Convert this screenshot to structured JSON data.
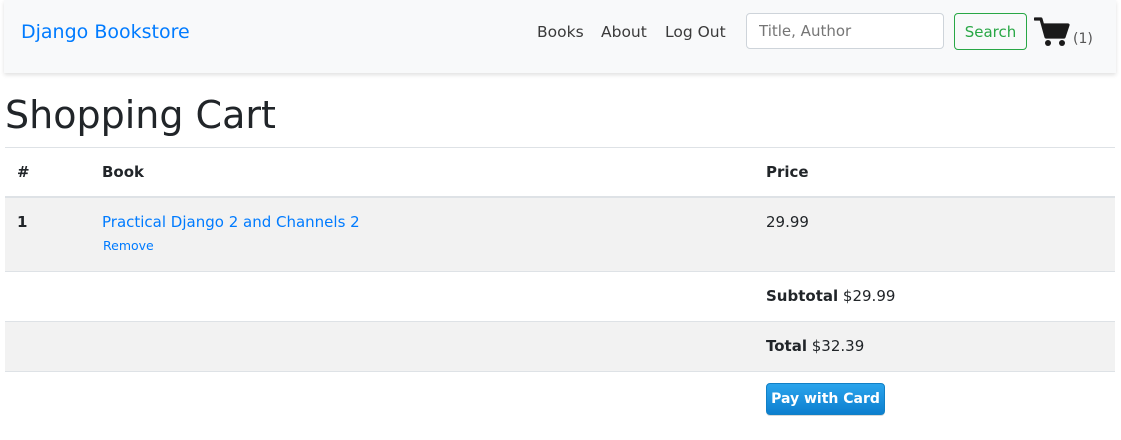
{
  "navbar": {
    "brand": "Django Bookstore",
    "links": [
      "Books",
      "About",
      "Log Out"
    ],
    "search_placeholder": "Title, Author",
    "search_button": "Search",
    "cart_icon": "shopping-cart-icon",
    "cart_count": "(1)"
  },
  "page": {
    "title": "Shopping Cart"
  },
  "table": {
    "headers": [
      "#",
      "Book",
      "Price"
    ],
    "items": [
      {
        "number": "1",
        "book": "Practical Django 2 and Channels 2",
        "remove_label": "Remove",
        "price": "29.99"
      }
    ],
    "subtotal_label": "Subtotal",
    "subtotal_value": "$29.99",
    "total_label": "Total",
    "total_value": "$32.39",
    "pay_button": "Pay with Card"
  },
  "colors": {
    "link": "#007bff",
    "search_button": "#28a745",
    "pay_button": "#1a8fdc",
    "navbar_bg": "#f8f9fa"
  }
}
